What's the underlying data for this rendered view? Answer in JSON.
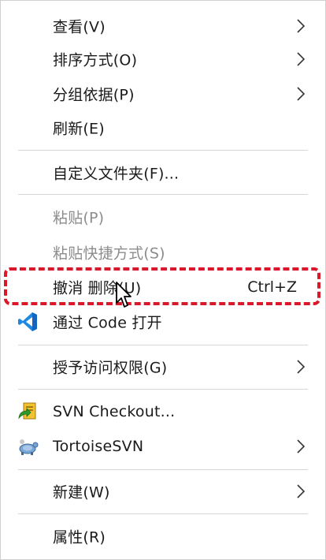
{
  "menu": {
    "items": [
      {
        "label": "查看(V)",
        "submenu": true
      },
      {
        "label": "排序方式(O)",
        "submenu": true
      },
      {
        "label": "分组依据(P)",
        "submenu": true
      },
      {
        "label": "刷新(E)"
      },
      {
        "label": "自定义文件夹(F)..."
      },
      {
        "label": "粘贴(P)",
        "disabled": true
      },
      {
        "label": "粘贴快捷方式(S)",
        "disabled": true
      },
      {
        "label": "撤消 删除(U)",
        "shortcut": "Ctrl+Z",
        "highlighted": true
      },
      {
        "label": "通过 Code 打开",
        "icon": "vscode-icon"
      },
      {
        "label": "授予访问权限(G)",
        "submenu": true
      },
      {
        "label": "SVN Checkout...",
        "icon": "svn-checkout-icon"
      },
      {
        "label": "TortoiseSVN",
        "icon": "tortoisesvn-icon",
        "submenu": true
      },
      {
        "label": "新建(W)",
        "submenu": true
      },
      {
        "label": "属性(R)"
      }
    ]
  },
  "colors": {
    "highlight_border": "#d9192a",
    "disabled_text": "#8c8c8c",
    "separator": "#d6d6d6",
    "vscode_blue": "#1e88e5"
  }
}
